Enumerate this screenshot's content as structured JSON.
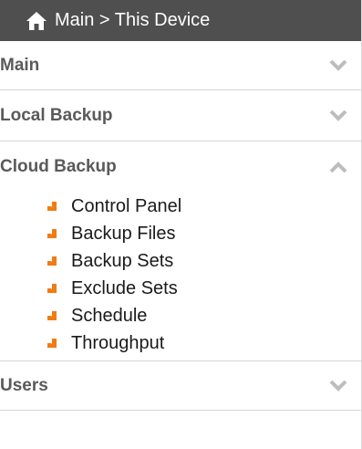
{
  "header": {
    "breadcrumb": "Main > This Device",
    "icon": "home-icon"
  },
  "sections": [
    {
      "label": "Main",
      "state": "collapsed",
      "icon": "chevron-down-icon"
    },
    {
      "label": "Local Backup",
      "state": "collapsed",
      "icon": "chevron-down-icon"
    },
    {
      "label": "Cloud Backup",
      "state": "expanded",
      "icon": "chevron-up-icon"
    },
    {
      "label": "Users",
      "state": "collapsed",
      "icon": "chevron-down-icon"
    }
  ],
  "cloud_backup_items": [
    {
      "label": "Control Panel"
    },
    {
      "label": "Backup Files"
    },
    {
      "label": "Backup Sets"
    },
    {
      "label": "Exclude Sets"
    },
    {
      "label": "Schedule"
    },
    {
      "label": "Throughput"
    }
  ],
  "colors": {
    "header_bg": "#4f4f4f",
    "section_text": "#5a5a5a",
    "chevron": "#bdbdbd",
    "bullet_arrow": "#f07c12",
    "divider": "#d6d6d6"
  }
}
